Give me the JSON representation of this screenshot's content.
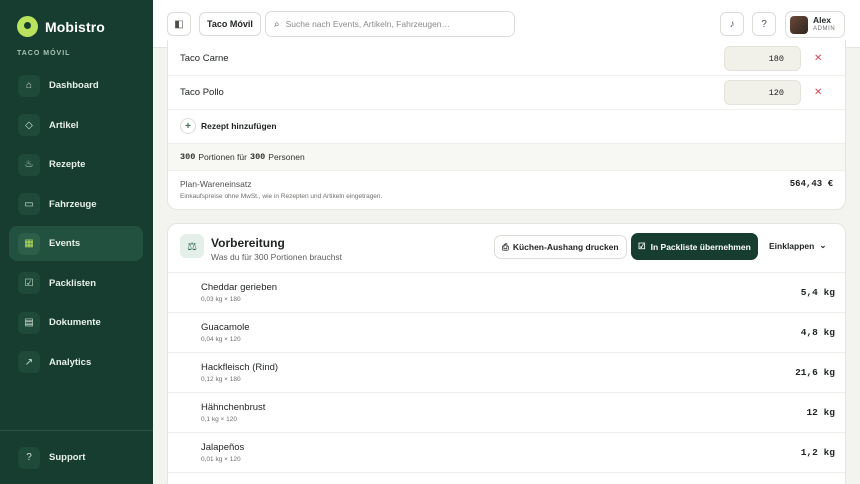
{
  "sidebar": {
    "brand": "Mobistro",
    "subtitle": "TACO MÓVIL",
    "items": [
      {
        "label": "Dashboard",
        "icon": "home-icon"
      },
      {
        "label": "Artikel",
        "icon": "artikel-icon"
      },
      {
        "label": "Rezepte",
        "icon": "recipe-icon"
      },
      {
        "label": "Fahrzeuge",
        "icon": "truck-icon"
      },
      {
        "label": "Events",
        "icon": "calendar-icon"
      },
      {
        "label": "Packlisten",
        "icon": "checklist-icon"
      },
      {
        "label": "Dokumente",
        "icon": "document-icon"
      },
      {
        "label": "Analytics",
        "icon": "chart-icon"
      }
    ],
    "support": "Support",
    "active": "Events"
  },
  "topbar": {
    "context_chip": "Taco Móvil",
    "search_placeholder": "Suche nach Events, Artikeln, Fahrzeugen…",
    "user_name": "Alex",
    "user_role": "ADMIN"
  },
  "recipes": {
    "rows": [
      {
        "name": "Taco Carne",
        "qty": "180"
      },
      {
        "name": "Taco Pollo",
        "qty": "120"
      }
    ],
    "add_label": "Rezept hinzufügen",
    "portions_count": "300",
    "portions_text": "Portionen für",
    "persons_count": "300",
    "persons_text": "Personen",
    "plan_label": "Plan-Wareneinsatz",
    "plan_note": "Einkaufspreise ohne MwSt., wie in Rezepten und Artikeln eingetragen.",
    "plan_value": "564,43 €"
  },
  "prep": {
    "title": "Vorbereitung",
    "subtitle": "Was du für 300 Portionen brauchst",
    "print_label": "Küchen-Aushang drucken",
    "apply_label": "In Packliste übernehmen",
    "collapse_label": "Einklappen",
    "items": [
      {
        "name": "Cheddar gerieben",
        "formula": "0,03 kg × 180",
        "amount": "5,4 kg"
      },
      {
        "name": "Guacamole",
        "formula": "0,04 kg × 120",
        "amount": "4,8 kg"
      },
      {
        "name": "Hackfleisch (Rind)",
        "formula": "0,12 kg × 180",
        "amount": "21,6 kg"
      },
      {
        "name": "Hähnchenbrust",
        "formula": "0,1 kg × 120",
        "amount": "12 kg"
      },
      {
        "name": "Jalapeños",
        "formula": "0,01 kg × 120",
        "amount": "1,2 kg"
      }
    ]
  },
  "colors": {
    "sidebar_bg": "#163d2f",
    "accent": "#b9e35c",
    "danger": "#d6455a"
  }
}
